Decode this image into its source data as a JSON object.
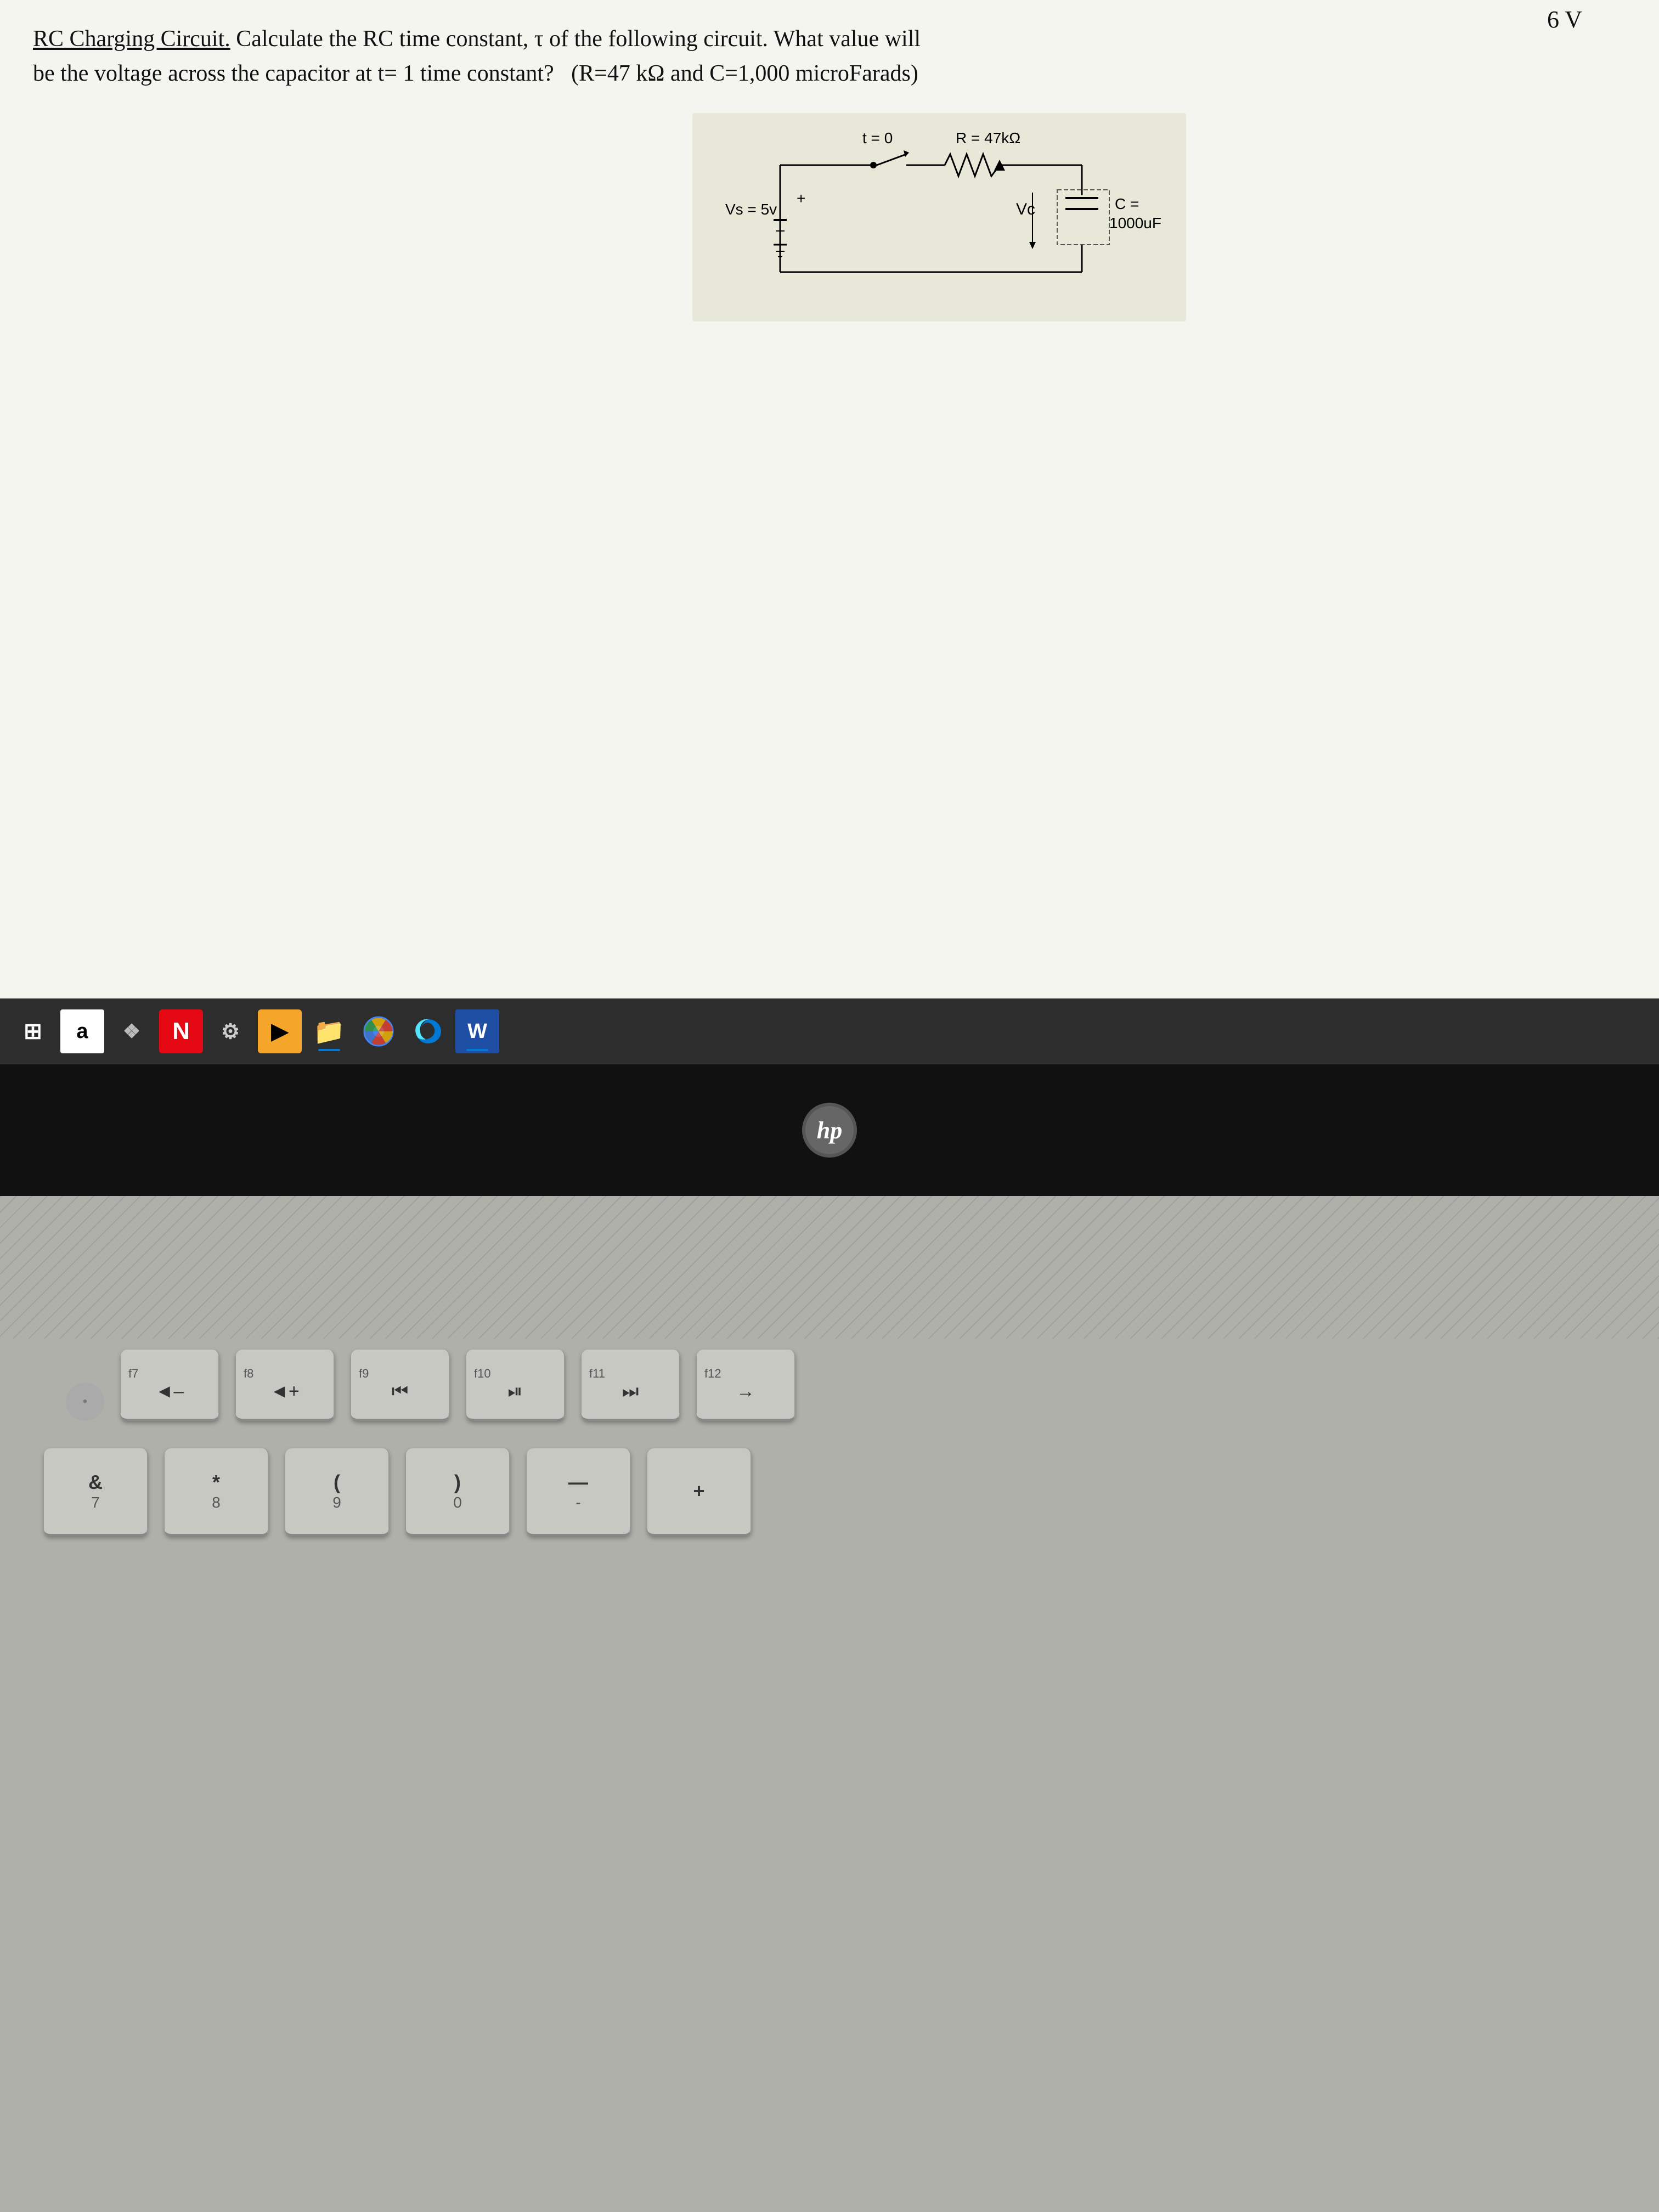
{
  "screen": {
    "voltage_top": "6 V",
    "question_line1": "RC Charging Circuit. Calculate the RC time constant, τ of the following circuit. What value will",
    "question_line2": "be the voltage across the capacitor at t= 1 time constant?   (R=47 kΩ and C=1,000 microFarads)",
    "circuit": {
      "t_label": "t = 0",
      "r_label": "R = 47kΩ",
      "vs_label": "Vs = 5v",
      "plus_label": "+",
      "minus_label": "-",
      "vc_label": "Vc",
      "c_label": "C =",
      "c_value": "1000uF"
    }
  },
  "taskbar": {
    "items": [
      {
        "name": "windows-start",
        "label": "⊞",
        "type": "start"
      },
      {
        "name": "amazon",
        "label": "a",
        "type": "amazon"
      },
      {
        "name": "four-squares",
        "label": "❖",
        "type": "grid"
      },
      {
        "name": "netflix",
        "label": "N",
        "type": "netflix"
      },
      {
        "name": "settings",
        "label": "⚙",
        "type": "settings"
      },
      {
        "name": "sticky-notes",
        "label": "▶",
        "type": "sticky"
      },
      {
        "name": "file-explorer",
        "label": "📁",
        "type": "folder"
      },
      {
        "name": "chrome",
        "label": "◎",
        "type": "chrome"
      },
      {
        "name": "edge",
        "label": "◑",
        "type": "edge"
      },
      {
        "name": "word",
        "label": "W",
        "type": "word"
      }
    ]
  },
  "hp_logo": "hp",
  "keyboard": {
    "row1": [
      {
        "fn": "f7",
        "icon": "◄",
        "char": null
      },
      {
        "fn": "f8",
        "icon": "◄+",
        "char": null
      },
      {
        "fn": "f9",
        "icon": "⏮",
        "char": null
      },
      {
        "fn": "f10",
        "icon": "▶⏸",
        "char": null
      },
      {
        "fn": "f11",
        "icon": "⏭",
        "char": null
      },
      {
        "fn": "f12",
        "icon": "→",
        "char": null
      }
    ],
    "row2": [
      {
        "top": "&",
        "bottom": "7"
      },
      {
        "top": "*",
        "bottom": "8"
      },
      {
        "top": "(",
        "bottom": "9"
      },
      {
        "top": ")",
        "bottom": "0"
      },
      {
        "top": "—",
        "bottom": "-"
      },
      {
        "top": "+",
        "bottom": null
      }
    ]
  }
}
